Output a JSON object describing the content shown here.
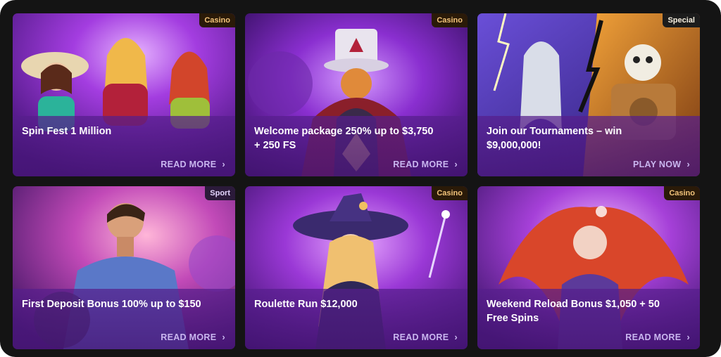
{
  "promotions": [
    {
      "badge": "Casino",
      "title": "Spin Fest 1 Million",
      "cta": "READ MORE"
    },
    {
      "badge": "Casino",
      "title": "Welcome package 250% up to $3,750 + 250 FS",
      "cta": "READ MORE"
    },
    {
      "badge": "Special",
      "title": "Join our Tournaments – win $9,000,000!",
      "cta": "PLAY NOW"
    },
    {
      "badge": "Sport",
      "title": "First Deposit Bonus 100% up to $150",
      "cta": "READ MORE"
    },
    {
      "badge": "Casino",
      "title": "Roulette Run $12,000",
      "cta": "READ MORE"
    },
    {
      "badge": "Casino",
      "title": "Weekend Reload Bonus $1,050 + 50 Free Spins",
      "cta": "READ MORE"
    }
  ],
  "colors": {
    "page_background": "#141414",
    "card_overlay": "#561e8c",
    "casino_badge_text": "#f2c37a",
    "cta_text": "#c9b6ef"
  },
  "icons": {
    "cta_arrow": "chevron-right-icon"
  }
}
